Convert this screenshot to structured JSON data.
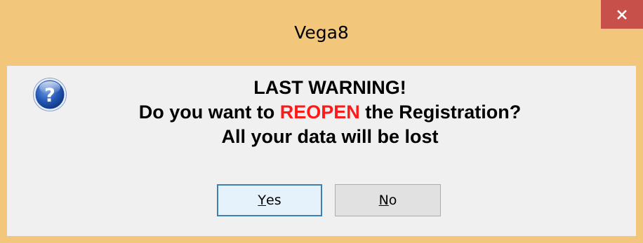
{
  "window": {
    "title": "Vega8",
    "close_icon": "close-icon"
  },
  "dialog": {
    "icon": "question-icon",
    "line1": "LAST WARNING!",
    "line2_before": "Do you want to ",
    "line2_highlight": "REOPEN",
    "line2_after": " the Registration?",
    "line3": "All your data will be lost",
    "highlight_color": "#ff1a1a"
  },
  "buttons": {
    "yes_accel": "Y",
    "yes_rest": "es",
    "no_accel": "N",
    "no_rest": "o"
  },
  "colors": {
    "frame": "#f2c77c",
    "close_button": "#c7504b",
    "client_background": "#f0f0f0",
    "default_button_border": "#3c7fb1"
  }
}
